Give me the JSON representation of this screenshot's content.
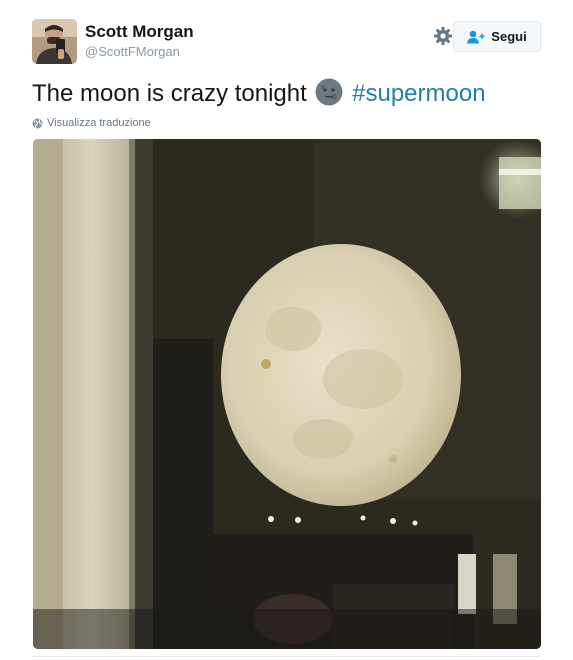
{
  "user": {
    "display_name": "Scott Morgan",
    "handle": "@ScottFMorgan"
  },
  "actions": {
    "follow_label": "Segui",
    "follow_icon": "add-user-icon",
    "settings_icon": "gear-icon"
  },
  "tweet": {
    "text": "The moon is crazy tonight",
    "emoji": "new-moon-face-emoji",
    "hashtag": "#supermoon"
  },
  "translate": {
    "label": "Visualizza traduzione",
    "icon": "globe-icon"
  },
  "colors": {
    "hashtag": "#1f7fa8",
    "name": "#14171a",
    "muted": "#8899a6"
  }
}
